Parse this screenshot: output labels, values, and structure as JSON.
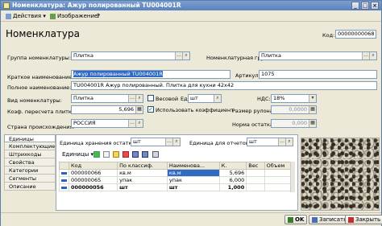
{
  "window": {
    "title": "Номенклатура: Ажур полированный TU004001R",
    "min": "_",
    "max": "□",
    "close": "×"
  },
  "toolbar": {
    "actions": "Действия",
    "image": "Изображение",
    "help": "?"
  },
  "header": {
    "title": "Номенклатура",
    "code_label": "Код:",
    "code_value": "00000000068"
  },
  "form": {
    "group_label": "Группа номенклатуры:",
    "group_value": "Плитка",
    "nom_group_label": "Номенклатурная группа:",
    "nom_group_value": "Плитка",
    "short_name_label": "Краткое наименование:",
    "short_name_value": "Ажур полированный TU004001R",
    "article_label": "Артикул:",
    "article_value": "1075",
    "full_name_label": "Полное наименование:",
    "full_name_value": "TU004001R Ажур полированный. Плитка для кухни 42х42",
    "kind_label": "Вид номенклатуры:",
    "kind_value": "Плитка",
    "weight_label": "Весовой",
    "unit_label": "Ед:",
    "unit_value": "шт",
    "vat_label": "НДС:",
    "vat_value": "18%",
    "coef_label": "Коэф. пересчета плитки:",
    "coef_value": "5,696",
    "use_coef_label": "Использовать коэффициент",
    "roll_label": "Размер рулона:",
    "roll_value": "0,0000",
    "country_label": "Страна происхождения:",
    "country_value": "РОССИЯ",
    "norm_label": "Норма остатка:",
    "norm_value": "0,000"
  },
  "tabs": [
    "Единицы",
    "Комплектующие",
    "Штрихкоды",
    "Свойства",
    "Категории",
    "Сегменты",
    "Описание"
  ],
  "units_panel": {
    "storage_label": "Единица хранения остатков:",
    "storage_value": "шт",
    "reports_label": "Единица для отчетов:",
    "reports_value": "шт",
    "units_menu": "Единицы",
    "columns": [
      "Код",
      "По классиф.",
      "Наименова...",
      "К.",
      "Вес",
      "Объем"
    ],
    "rows": [
      {
        "code": "000000066",
        "classif": "кв.м",
        "name": "кв.м",
        "k": "5,696",
        "weight": "",
        "volume": ""
      },
      {
        "code": "000000065",
        "classif": "упак",
        "name": "упак",
        "k": "6,000",
        "weight": "",
        "volume": ""
      },
      {
        "code": "000000056",
        "classif": "шт",
        "name": "шт",
        "k": "1,000",
        "weight": "",
        "volume": ""
      }
    ]
  },
  "buttons": {
    "ok": "OK",
    "save": "Записать",
    "close": "Закрыть"
  }
}
